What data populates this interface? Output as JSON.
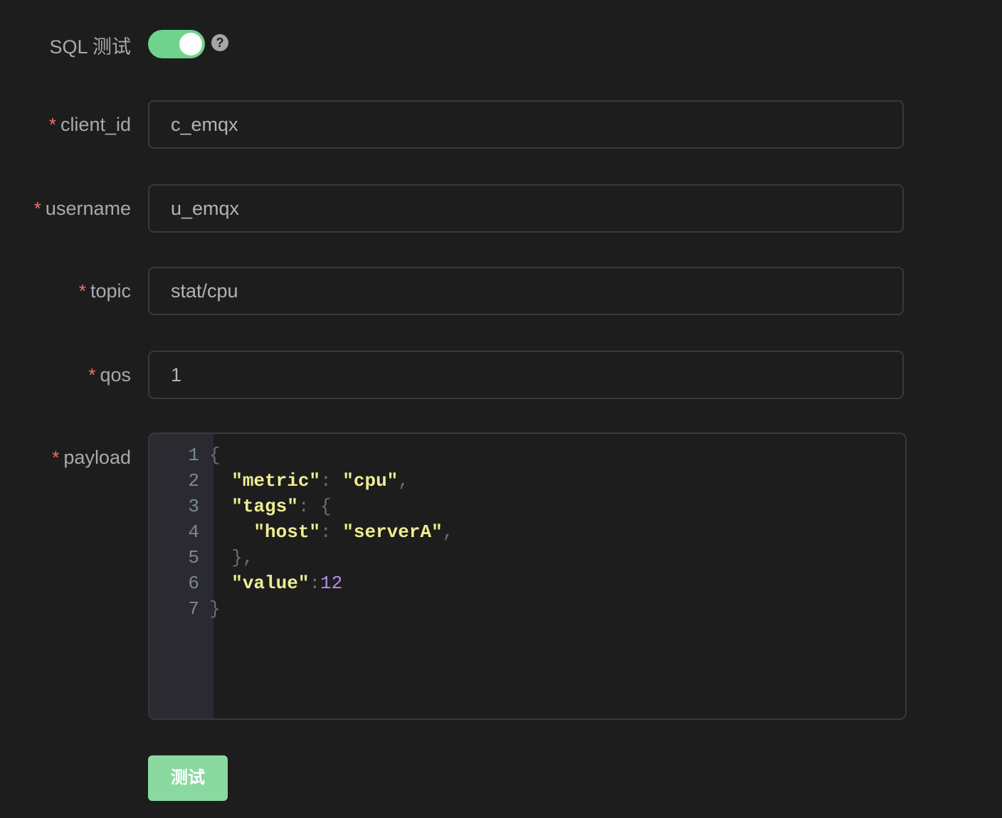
{
  "sql_test": {
    "label": "SQL 测试",
    "enabled": true,
    "help_icon": "question-circle-icon",
    "accent_color": "#6fd38e"
  },
  "fields": [
    {
      "name": "client_id",
      "label": "client_id",
      "required": true,
      "value": "c_emqx"
    },
    {
      "name": "username",
      "label": "username",
      "required": true,
      "value": "u_emqx"
    },
    {
      "name": "topic",
      "label": "topic",
      "required": true,
      "value": "stat/cpu"
    },
    {
      "name": "qos",
      "label": "qos",
      "required": true,
      "value": "1"
    }
  ],
  "payload": {
    "label": "payload",
    "required": true,
    "line_numbers": [
      "1",
      "2",
      "3",
      "4",
      "5",
      "6",
      "7"
    ],
    "lines": [
      [
        {
          "t": "punc",
          "v": "{"
        }
      ],
      [
        {
          "t": "ws",
          "v": "  "
        },
        {
          "t": "str",
          "v": "\"metric\""
        },
        {
          "t": "punc",
          "v": ": "
        },
        {
          "t": "str",
          "v": "\"cpu\""
        },
        {
          "t": "punc",
          "v": ","
        }
      ],
      [
        {
          "t": "ws",
          "v": "  "
        },
        {
          "t": "str",
          "v": "\"tags\""
        },
        {
          "t": "punc",
          "v": ": {"
        }
      ],
      [
        {
          "t": "ws",
          "v": "    "
        },
        {
          "t": "str",
          "v": "\"host\""
        },
        {
          "t": "punc",
          "v": ": "
        },
        {
          "t": "str",
          "v": "\"serverA\""
        },
        {
          "t": "punc",
          "v": ","
        }
      ],
      [
        {
          "t": "ws",
          "v": "  "
        },
        {
          "t": "punc",
          "v": "},"
        }
      ],
      [
        {
          "t": "ws",
          "v": "  "
        },
        {
          "t": "str",
          "v": "\"value\""
        },
        {
          "t": "punc",
          "v": ":"
        },
        {
          "t": "num",
          "v": "12"
        }
      ],
      [
        {
          "t": "punc",
          "v": "}"
        }
      ]
    ]
  },
  "required_marker": "*",
  "submit_button": {
    "label": "测试",
    "color": "#8ad9a1"
  }
}
